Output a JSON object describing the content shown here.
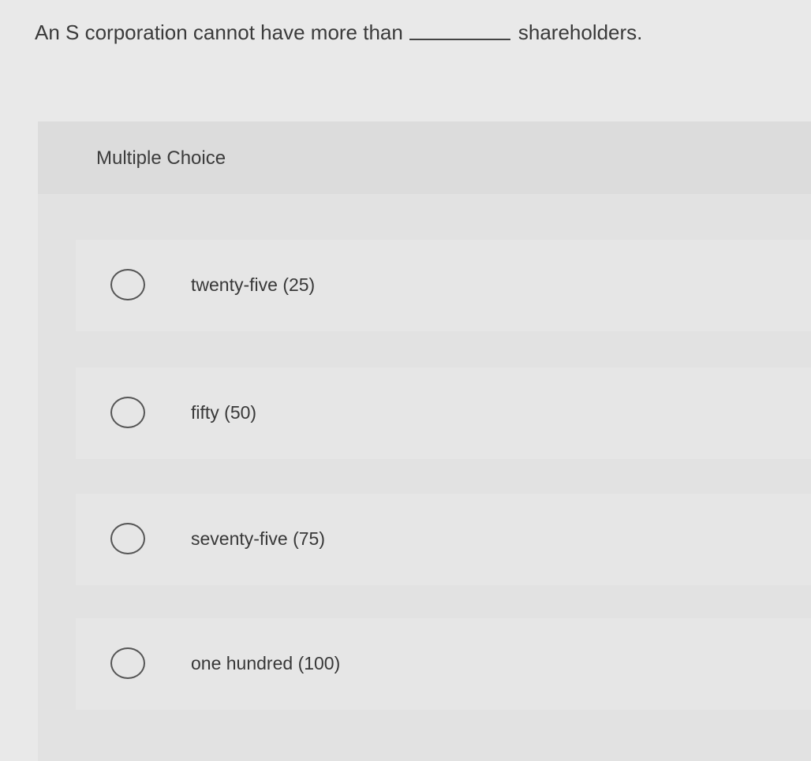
{
  "question": {
    "before": "An S corporation cannot have more than",
    "after": "shareholders."
  },
  "section_label": "Multiple Choice",
  "options": [
    {
      "label": "twenty-five (25)",
      "selected": false
    },
    {
      "label": "fifty (50)",
      "selected": false
    },
    {
      "label": "seventy-five (75)",
      "selected": false
    },
    {
      "label": "one hundred (100)",
      "selected": false
    }
  ]
}
